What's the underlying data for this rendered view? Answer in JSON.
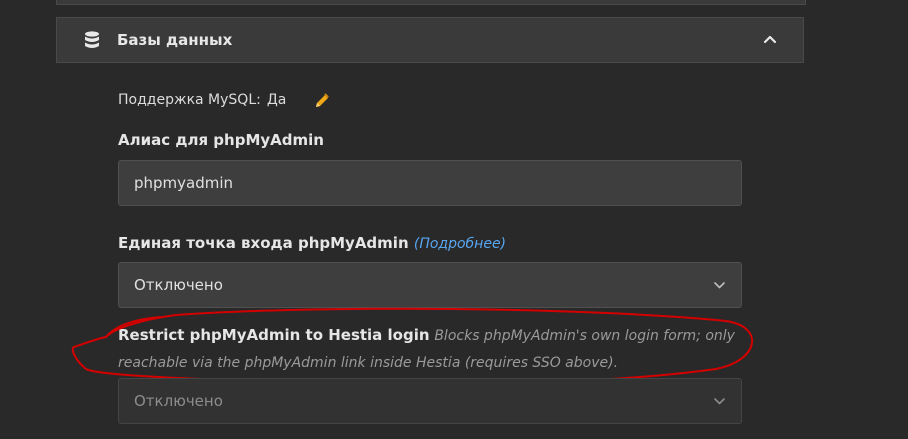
{
  "section": {
    "title": "Базы данных",
    "icon": "database-icon"
  },
  "mysql": {
    "label": "Поддержка MySQL:",
    "value": "Да"
  },
  "alias": {
    "label": "Алиас для phpMyAdmin",
    "value": "phpmyadmin"
  },
  "sso": {
    "label": "Единая точка входа phpMyAdmin",
    "more_link": "(Подробнее)",
    "selected": "Отключено"
  },
  "restrict": {
    "title": "Restrict phpMyAdmin to Hestia login",
    "description": "Blocks phpMyAdmin's own login form; only reachable via the phpMyAdmin link inside Hestia (requires SSO above).",
    "selected": "Отключено"
  },
  "colors": {
    "background": "#292929",
    "link": "#58a6f0",
    "pencil": "#f0a818",
    "annotation": "#d40000"
  }
}
